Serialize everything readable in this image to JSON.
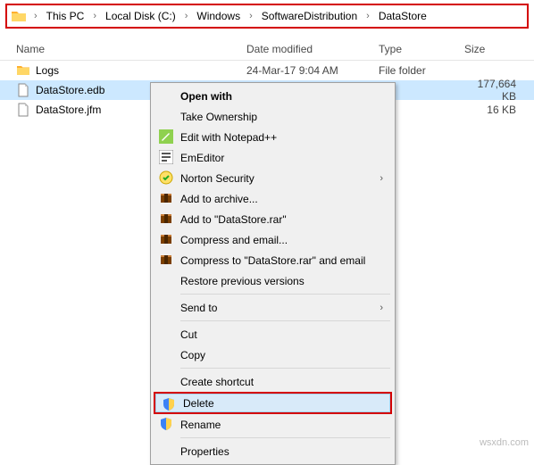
{
  "breadcrumb": {
    "items": [
      "This PC",
      "Local Disk (C:)",
      "Windows",
      "SoftwareDistribution",
      "DataStore"
    ]
  },
  "columns": {
    "name": "Name",
    "date": "Date modified",
    "type": "Type",
    "size": "Size"
  },
  "files": [
    {
      "name": "Logs",
      "date": "24-Mar-17 9:04 AM",
      "type": "File folder",
      "size": "",
      "kind": "folder",
      "selected": false
    },
    {
      "name": "DataStore.edb",
      "date": "",
      "type": "",
      "size": "177,664 KB",
      "kind": "file",
      "selected": true
    },
    {
      "name": "DataStore.jfm",
      "date": "",
      "type": "",
      "size": "16 KB",
      "kind": "file",
      "selected": false
    }
  ],
  "ctx": {
    "open_with": "Open with",
    "take_ownership": "Take Ownership",
    "edit_npp": "Edit with Notepad++",
    "emeditor": "EmEditor",
    "norton": "Norton Security",
    "add_archive": "Add to archive...",
    "add_rar": "Add to \"DataStore.rar\"",
    "compress_email": "Compress and email...",
    "compress_rar_email": "Compress to \"DataStore.rar\" and email",
    "restore_prev": "Restore previous versions",
    "send_to": "Send to",
    "cut": "Cut",
    "copy": "Copy",
    "create_shortcut": "Create shortcut",
    "delete": "Delete",
    "rename": "Rename",
    "properties": "Properties"
  },
  "watermark": "wsxdn.com"
}
